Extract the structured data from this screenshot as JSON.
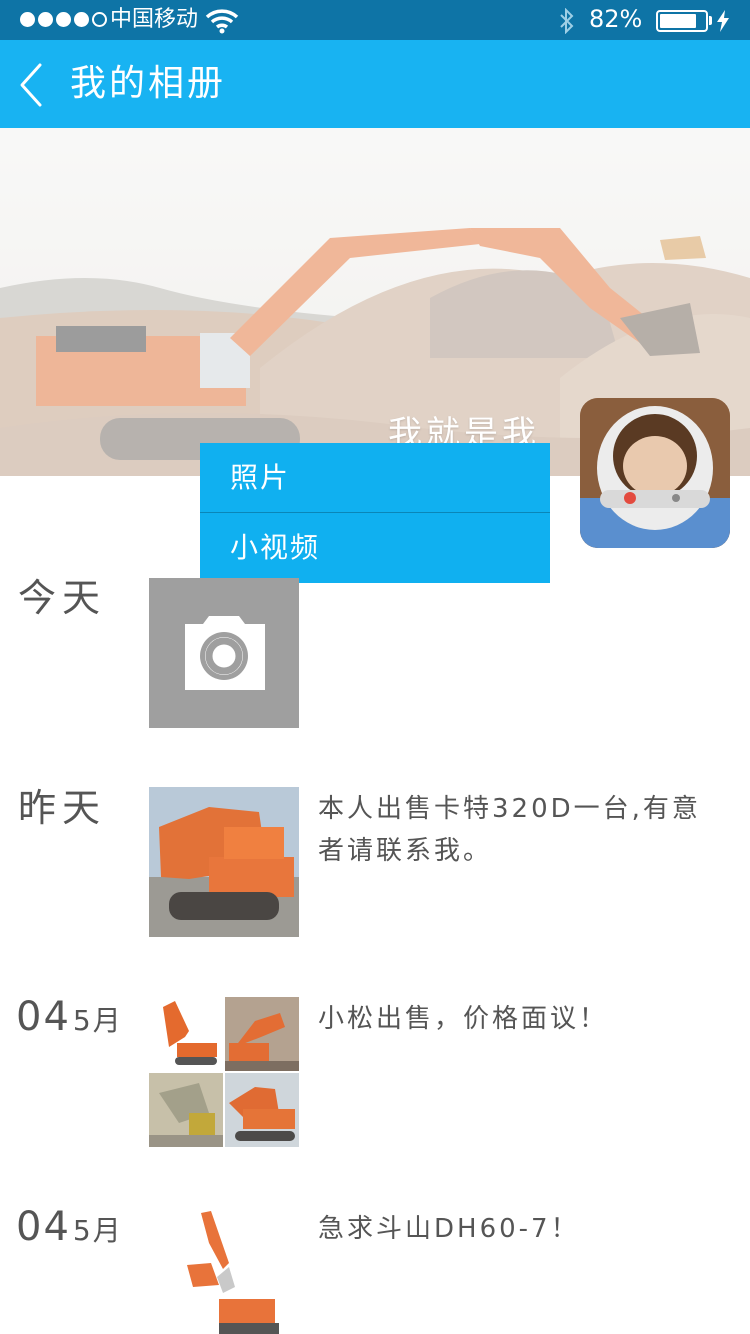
{
  "status_bar": {
    "carrier": "中国移动",
    "battery": "82%",
    "battery_level": 0.82
  },
  "nav": {
    "title": "我的相册"
  },
  "profile": {
    "name": "我就是我"
  },
  "dropdown": {
    "items": [
      "照片",
      "小视频"
    ]
  },
  "timeline": {
    "today": "今天",
    "posts": [
      {
        "date_day": "昨天",
        "text": "本人出售卡特320D一台,有意者请联系我。"
      },
      {
        "date_num": "04",
        "date_month": "5月",
        "text": "小松出售，价格面议！"
      },
      {
        "date_num": "04",
        "date_month": "5月",
        "text": "急求斗山DH60-7！"
      }
    ]
  },
  "colors": {
    "status_bar": "#0e74a6",
    "nav_bar": "#18b3f2",
    "dropdown": "#10b0f0",
    "camera_tile": "#9f9f9f",
    "excavator": "#e8733a"
  }
}
